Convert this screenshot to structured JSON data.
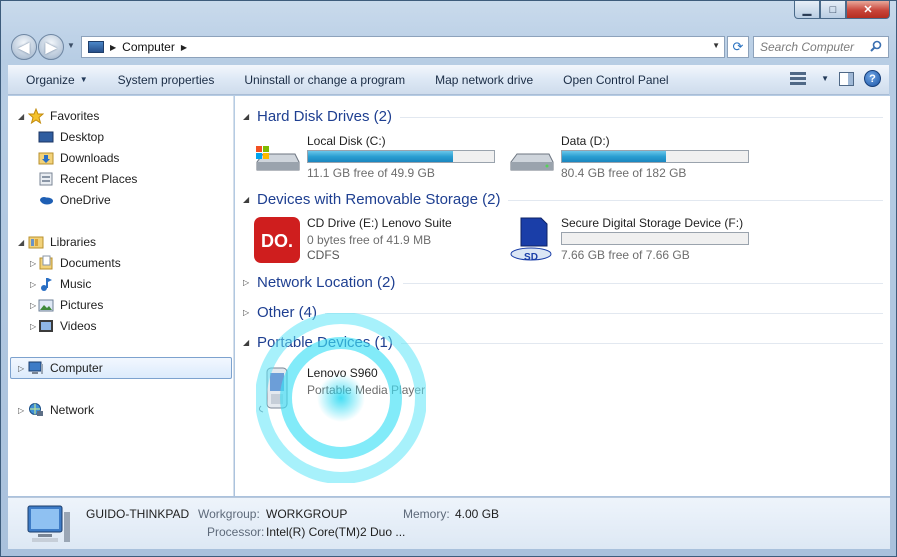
{
  "window": {
    "caption": {
      "minimize": "▁",
      "maximize": "□",
      "close": "✕"
    }
  },
  "address": {
    "path": [
      "Computer"
    ],
    "search_placeholder": "Search Computer"
  },
  "toolbar": {
    "organize": "Organize",
    "system_properties": "System properties",
    "uninstall": "Uninstall or change a program",
    "map_drive": "Map network drive",
    "control_panel": "Open Control Panel",
    "help": "?"
  },
  "navpane": {
    "favorites": {
      "label": "Favorites",
      "items": [
        {
          "label": "Desktop",
          "icon": "desktop-icon"
        },
        {
          "label": "Downloads",
          "icon": "downloads-folder-icon"
        },
        {
          "label": "Recent Places",
          "icon": "recent-places-icon"
        },
        {
          "label": "OneDrive",
          "icon": "onedrive-icon"
        }
      ]
    },
    "libraries": {
      "label": "Libraries",
      "items": [
        {
          "label": "Documents",
          "icon": "documents-icon"
        },
        {
          "label": "Music",
          "icon": "music-icon"
        },
        {
          "label": "Pictures",
          "icon": "pictures-icon"
        },
        {
          "label": "Videos",
          "icon": "videos-icon"
        }
      ]
    },
    "computer": "Computer",
    "network": "Network"
  },
  "content": {
    "groups": {
      "hdd": "Hard Disk Drives (2)",
      "removable": "Devices with Removable Storage (2)",
      "network": "Network Location (2)",
      "other": "Other (4)",
      "portable": "Portable Devices (1)"
    },
    "drives": {
      "c": {
        "name": "Local Disk (C:)",
        "free": "11.1 GB free of 49.9 GB",
        "used_fraction": 0.78
      },
      "d": {
        "name": "Data (D:)",
        "free": "80.4 GB free of 182 GB",
        "used_fraction": 0.56
      },
      "e": {
        "name": "CD Drive (E:) Lenovo Suite",
        "free": "0 bytes free of 41.9 MB",
        "fs": "CDFS",
        "logo": "DO."
      },
      "f": {
        "name": "Secure Digital Storage Device (F:)",
        "free": "7.66 GB free of 7.66 GB",
        "used_fraction": 0.0
      },
      "phone": {
        "name": "Lenovo S960",
        "type": "Portable Media Player"
      }
    }
  },
  "details": {
    "computer_name": "GUIDO-THINKPAD",
    "workgroup_label": "Workgroup:",
    "workgroup": "WORKGROUP",
    "memory_label": "Memory:",
    "memory": "4.00 GB",
    "processor_label": "Processor:",
    "processor": "Intel(R) Core(TM)2 Duo ..."
  },
  "colors": {
    "accent": "#1e3f91",
    "bar": "#2a9fd2",
    "selection": "#dcebfc"
  }
}
